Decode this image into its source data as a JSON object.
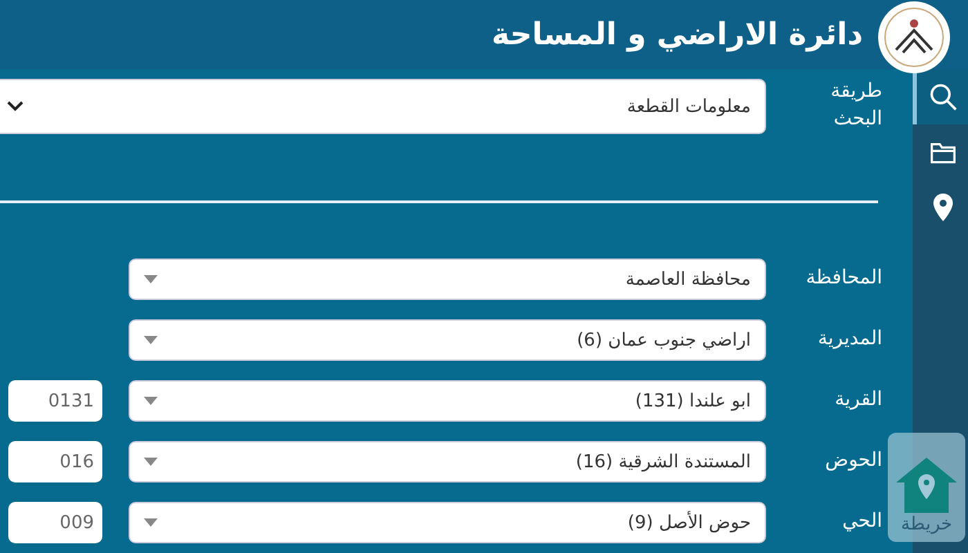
{
  "header": {
    "title": "دائرة الاراضي و المساحة"
  },
  "sidebar": {
    "items": [
      {
        "kind": "search",
        "selected": true
      },
      {
        "kind": "folder",
        "selected": false
      },
      {
        "kind": "pin",
        "selected": false
      }
    ]
  },
  "search_method": {
    "label": "طريقة البحث",
    "value": "معلومات القطعة"
  },
  "fields": [
    {
      "label": "المحافظة",
      "value": "محافظة العاصمة"
    },
    {
      "label": "المديرية",
      "value": "اراضي جنوب عمان (6)"
    },
    {
      "label": "القرية",
      "value": "ابو علندا (131)",
      "code": "0131"
    },
    {
      "label": "الحوض",
      "value": "المستندة الشرقية (16)",
      "code": "016"
    },
    {
      "label": "الحي",
      "value": "حوض الأصل (9)",
      "code": "009"
    }
  ],
  "map_button": {
    "label": "خريطة"
  }
}
